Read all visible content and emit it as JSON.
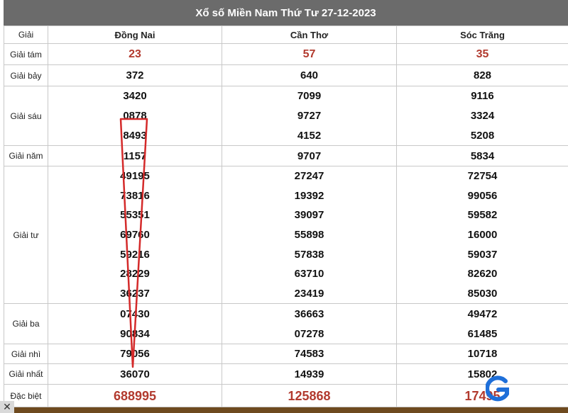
{
  "title": "Xổ số Miền Nam Thứ Tư 27-12-2023",
  "header": {
    "label": "Giải",
    "provinces": [
      "Đồng Nai",
      "Cần Thơ",
      "Sóc Trăng"
    ]
  },
  "prizes": [
    {
      "name": "Giải tám",
      "style": "red",
      "values": [
        [
          "23"
        ],
        [
          "57"
        ],
        [
          "35"
        ]
      ]
    },
    {
      "name": "Giải bảy",
      "values": [
        [
          "372"
        ],
        [
          "640"
        ],
        [
          "828"
        ]
      ]
    },
    {
      "name": "Giải sáu",
      "values": [
        [
          "3420",
          "0878",
          "8493"
        ],
        [
          "7099",
          "9727",
          "4152"
        ],
        [
          "9116",
          "3324",
          "5208"
        ]
      ]
    },
    {
      "name": "Giải năm",
      "values": [
        [
          "1157"
        ],
        [
          "9707"
        ],
        [
          "5834"
        ]
      ]
    },
    {
      "name": "Giải tư",
      "values": [
        [
          "49195",
          "73816",
          "55351",
          "69760",
          "59216",
          "28229",
          "36237"
        ],
        [
          "27247",
          "19392",
          "39097",
          "55898",
          "57838",
          "63710",
          "23419"
        ],
        [
          "72754",
          "99056",
          "59582",
          "16000",
          "59037",
          "82620",
          "85030"
        ]
      ]
    },
    {
      "name": "Giải ba",
      "values": [
        [
          "07430",
          "90834"
        ],
        [
          "36663",
          "07278"
        ],
        [
          "49472",
          "61485"
        ]
      ]
    },
    {
      "name": "Giải nhì",
      "values": [
        [
          "79056"
        ],
        [
          "74583"
        ],
        [
          "10718"
        ]
      ]
    },
    {
      "name": "Giải nhất",
      "values": [
        [
          "36070"
        ],
        [
          "14939"
        ],
        [
          "15802"
        ]
      ]
    },
    {
      "name": "Đặc biệt",
      "style": "special",
      "values": [
        [
          "688995"
        ],
        [
          "125868"
        ],
        [
          "17495"
        ]
      ]
    }
  ],
  "colors": {
    "title_bg": "#6b6b6b",
    "accent_red": "#b23a2e",
    "annotation_red": "#d42a2a",
    "logo_blue": "#1e6fd9"
  },
  "icons": {
    "close": "close-icon",
    "logo": "g-logo-icon"
  },
  "close_glyph": "✕"
}
